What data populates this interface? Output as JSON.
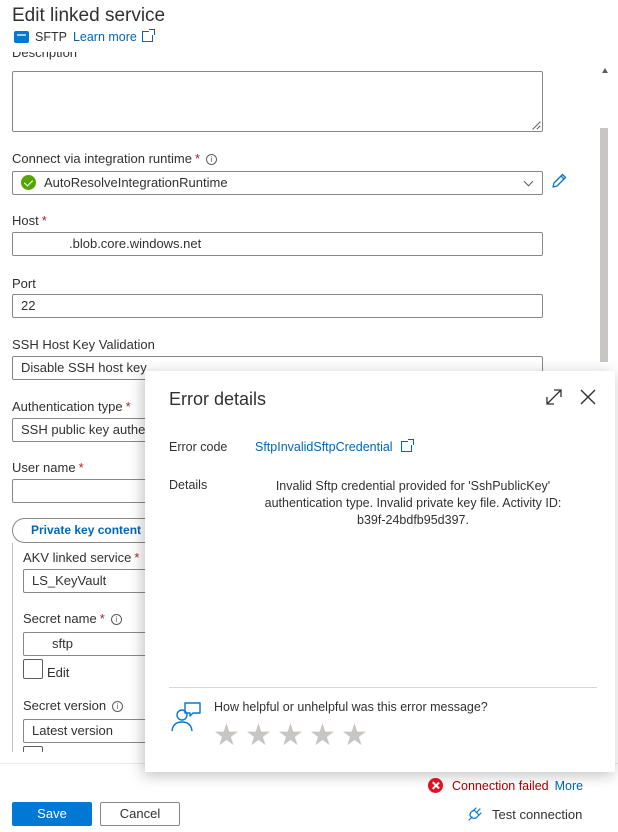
{
  "header": {
    "title": "Edit linked service",
    "service_type": "SFTP",
    "learn_more": "Learn more"
  },
  "form": {
    "description_label": "Description",
    "ir_label": "Connect via integration runtime",
    "ir_value": "AutoResolveIntegrationRuntime",
    "host_label": "Host",
    "host_value": ".blob.core.windows.net",
    "port_label": "Port",
    "port_value": "22",
    "ssh_label": "SSH Host Key Validation",
    "ssh_value": "Disable SSH host key",
    "auth_label": "Authentication type",
    "auth_value": "SSH public key authen",
    "username_label": "User name",
    "username_value": "",
    "private_key_tab": "Private key content",
    "akv_label": "AKV linked service",
    "akv_value": "LS_KeyVault",
    "secret_name_label": "Secret name",
    "secret_name_value": "sftp",
    "edit_label": "Edit",
    "secret_version_label": "Secret version",
    "secret_version_value": "Latest version",
    "required_mark": "*",
    "info_glyph": "i"
  },
  "footer": {
    "connection_status": "Connection failed",
    "more": "More",
    "save": "Save",
    "cancel": "Cancel",
    "test_connection": "Test connection"
  },
  "error_panel": {
    "title": "Error details",
    "code_label": "Error code",
    "code_value": "SftpInvalidSftpCredential",
    "details_label": "Details",
    "details_value": "Invalid Sftp credential provided for 'SshPublicKey' authentication type. Invalid private key file. Activity ID: b39f-24bdfb95d397.",
    "feedback_question": "How helpful or unhelpful was this error message?",
    "star_glyph": "★",
    "rating_stars": 5
  },
  "colors": {
    "accent": "#0078d4",
    "link": "#0067b8",
    "error": "#e81123",
    "success": "#57a300"
  }
}
